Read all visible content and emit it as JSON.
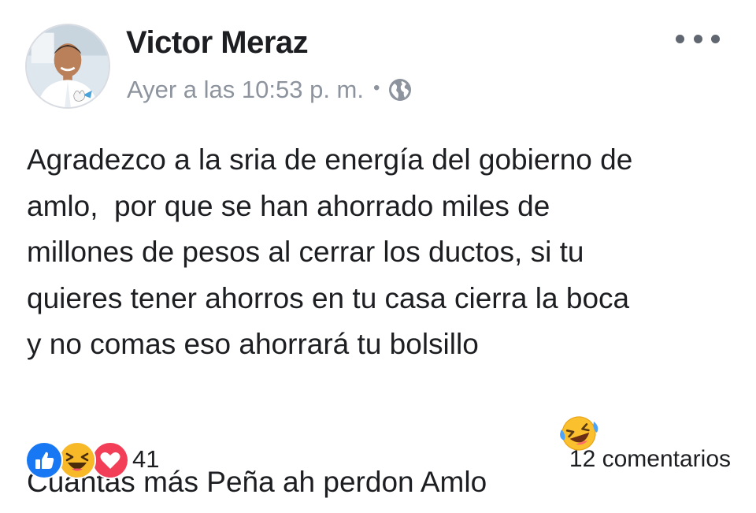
{
  "post": {
    "author": "Victor Meraz",
    "timestamp": "Ayer a las 10:53 p. m.",
    "separator": "•",
    "privacy_icon": "globe-icon",
    "more_icon": "more-options-icon",
    "body_lines": [
      "Agradezco a la sria de energía del gobierno de",
      "amlo,  por que se han ahorrado miles de",
      "millones de pesos al cerrar los ductos, si tu",
      "quieres tener ahorros en tu casa cierra la boca",
      "y no comas eso ahorrará tu bolsillo",
      "Cuantas más Peña ah perdon Amlo"
    ],
    "inline_emoji": "laughing-tears-emoji"
  },
  "reactions": {
    "icons": [
      "like-reaction-icon",
      "haha-reaction-icon",
      "love-reaction-icon"
    ],
    "count": "41"
  },
  "comments": {
    "label": "12 comentarios"
  },
  "colors": {
    "text": "#1c1e21",
    "secondary": "#8d949e",
    "like_blue": "#1877f2",
    "love_red": "#f33e58",
    "haha_yellow": "#f7b928"
  }
}
